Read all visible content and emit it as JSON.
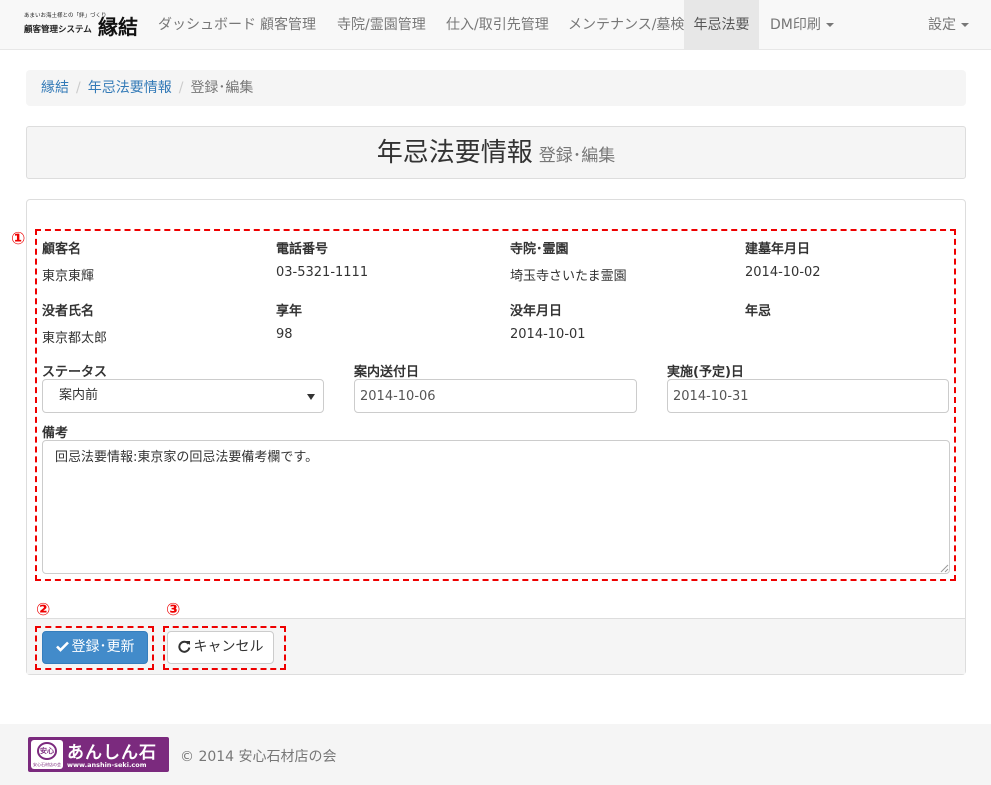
{
  "brand": {
    "tagline": "あまいお海土様との「絆」づくり",
    "system_name": "顧客管理システム",
    "name": "縁結"
  },
  "nav": {
    "items": [
      {
        "label": "ダッシュボード"
      },
      {
        "label": "顧客管理"
      },
      {
        "label": "寺院/霊園管理"
      },
      {
        "label": "仕入/取引先管理"
      },
      {
        "label": "メンテナンス/墓検"
      },
      {
        "label": "年忌法要",
        "active": true
      },
      {
        "label": "DM印刷",
        "dropdown": true
      }
    ],
    "settings": {
      "label": "設定",
      "dropdown": true
    }
  },
  "breadcrumb": [
    "縁結",
    "年忌法要情報",
    "登録･編集"
  ],
  "page_header": {
    "title": "年忌法要情報",
    "subtitle": "登録･編集"
  },
  "info": {
    "customer_name": {
      "label": "顧客名",
      "value": "東京東輝"
    },
    "phone": {
      "label": "電話番号",
      "value": "03-5321-1111"
    },
    "temple": {
      "label": "寺院･霊園",
      "value": "埼玉寺さいたま霊園"
    },
    "grave_date": {
      "label": "建墓年月日",
      "value": "2014-10-02"
    },
    "deceased_name": {
      "label": "没者氏名",
      "value": "東京都太郎"
    },
    "age": {
      "label": "享年",
      "value": "98"
    },
    "death_date": {
      "label": "没年月日",
      "value": "2014-10-01"
    },
    "anniversary": {
      "label": "年忌",
      "value": ""
    }
  },
  "form": {
    "status": {
      "label": "ステータス",
      "value": "案内前"
    },
    "guide_sent": {
      "label": "案内送付日",
      "value": "2014-10-06"
    },
    "scheduled": {
      "label": "実施(予定)日",
      "value": "2014-10-31"
    },
    "notes": {
      "label": "備考",
      "value": "回忌法要情報:東京家の回忌法要備考欄です。"
    }
  },
  "buttons": {
    "submit": "登録･更新",
    "cancel": "キャンセル"
  },
  "annotations": [
    "①",
    "②",
    "③"
  ],
  "footer": {
    "logo_title": "あんしん石",
    "logo_url": "www.anshin-seki.com",
    "logo_mark": "安心",
    "logo_mark_caption": "安心石材店の会",
    "copyright": "© 2014 安心石材店の会"
  },
  "colors": {
    "primary": "#428bca",
    "annotation": "#ee0000",
    "link": "#337ab7",
    "logo": "#7b2a7e"
  }
}
